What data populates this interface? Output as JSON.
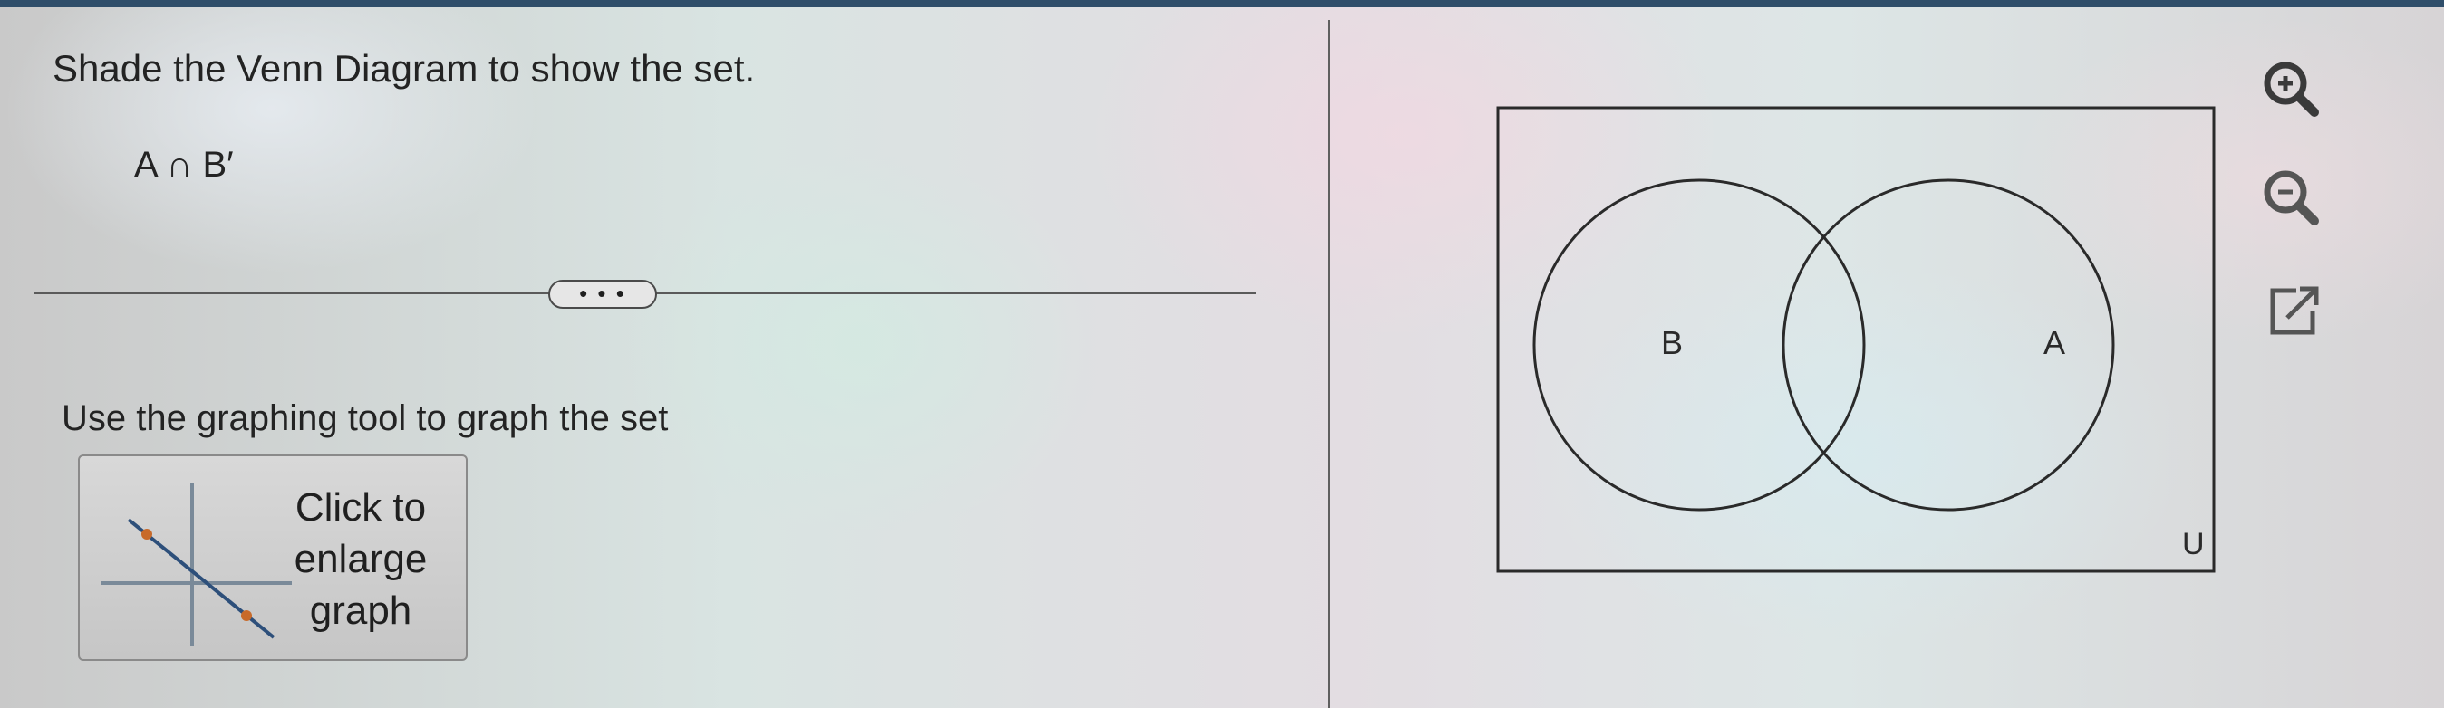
{
  "question": {
    "prompt": "Shade the Venn Diagram to show the set.",
    "expression": "A ∩ B′"
  },
  "more_button": {
    "label": "• • •"
  },
  "graph_tool": {
    "instruction": "Use the graphing tool to graph the set",
    "button_label": "Click to\nenlarge\ngraph"
  },
  "venn": {
    "circle_left_label": "B",
    "circle_right_label": "A",
    "universe_label": "U"
  },
  "toolbar": {
    "icons": [
      "zoom-in-icon",
      "zoom-out-icon",
      "popout-icon"
    ]
  },
  "colors": {
    "accent_blue": "#2f4e6a",
    "icon_gray": "#5a5a5a"
  }
}
